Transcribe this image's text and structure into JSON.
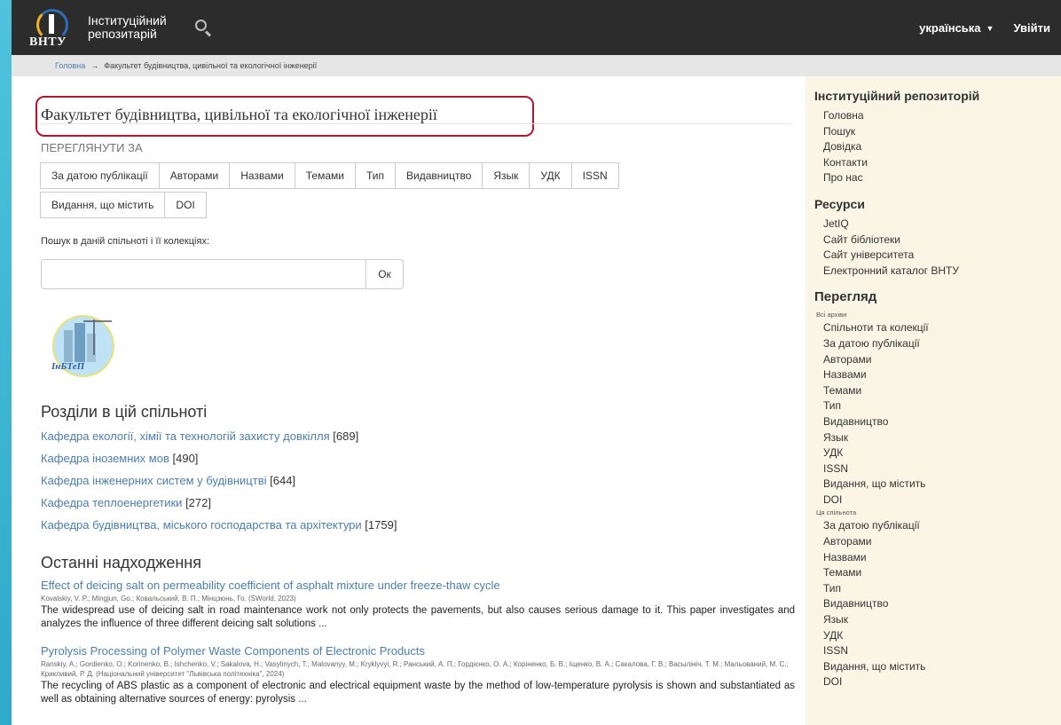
{
  "navbar": {
    "logo_text": "ВНТУ",
    "brand_line1": "Інституційний",
    "brand_line2": "репозитарій",
    "language": "українська",
    "login": "Увійти"
  },
  "breadcrumb": {
    "home": "Головна",
    "separator": "→",
    "current": "Факультет будівництва, цивільної та екологічної інженерії"
  },
  "main": {
    "title": "Факультет будівництва, цивільної та екологічної інженерії",
    "browse_label": "ПЕРЕГЛЯНУТИ ЗА",
    "browse_buttons_row1": [
      "За датою публікації",
      "Авторами",
      "Назвами",
      "Темами",
      "Тип",
      "Видавництво",
      "Язык",
      "УДК",
      "ISSN"
    ],
    "browse_buttons_row2": [
      "Видання, що містить",
      "DOI"
    ],
    "search_label": "Пошук в даній спільноті і її колекціях:",
    "search_button": "Ок",
    "logo_text": "ІнБТеП",
    "subdivisions_heading": "Розділи в цій спільноті",
    "subdivisions": [
      {
        "name": "Кафедра екології, хімії та технологій захисту довкілля",
        "count": "[689]"
      },
      {
        "name": "Кафедра іноземних мов",
        "count": "[490]"
      },
      {
        "name": "Кафедра інженерних систем у будівництві",
        "count": "[644]"
      },
      {
        "name": "Кафедра теплоенергетики",
        "count": "[272]"
      },
      {
        "name": "Кафедра будівництва, міського господарства та архітектури",
        "count": "[1759]"
      }
    ],
    "recent_heading": "Останні надходження",
    "recent": [
      {
        "title": "Effect of deicing salt on permeability coefficient of asphalt mixture under freeze-thaw cycle",
        "authors": "Kovalskiy, V. P.; Mingjun, Go.; Ковальський, В. П.; Мінцзюнь, Го. (SWorld, 2023)",
        "abstract": "The widespread use of deicing salt in road maintenance work not only protects the pavements, but also causes serious damage to it. This paper investigates and analyzes the influence of three different deicing salt solutions ..."
      },
      {
        "title": "Pyrolysis Processing of Polymer Waste Components of Electronic Products",
        "authors": "Ranskiy, A.; Gordienko, O.; Korinenko, B.; Ishchenko, V.; Sakalova, H.; Vasylinych, T.; Malovanyy, M.; Kryklyvyi, R.; Ранський, А. П.; Гордієнко, О. А.; Коріненко, Б. В.; Іщенко, В. А.; Сакалова, Г. В.; Васылініч, Т. М.; Мальований, М. С.; Крикливий, Р. Д. (Національний університет \"Львівська політехніка\", 2024)",
        "abstract": "The recycling of ABS plastic as a component of electronic and electrical equipment waste by the method of low-temperature pyrolysis is shown and substantiated as well as obtaining alternative sources of energy: pyrolysis ..."
      }
    ]
  },
  "sidebar": {
    "repo_heading": "Інституційний репозиторій",
    "repo_items": [
      "Головна",
      "Пошук",
      "Довідка",
      "Контакти",
      "Про нас"
    ],
    "resources_heading": "Ресурси",
    "resources_items": [
      "JetIQ",
      "Сайт бібліотеки",
      "Сайт університета",
      "Електронний каталог ВНТУ"
    ],
    "browse_heading": "Перегляд",
    "all_archives_label": "Всі архіви",
    "all_archives_items": [
      "Спільноти та колекції",
      "За датою публікації",
      "Авторами",
      "Назвами",
      "Темами",
      "Тип",
      "Видавництво",
      "Язык",
      "УДК",
      "ISSN",
      "Видання, що містить",
      "DOI"
    ],
    "this_community_label": "Ця спільнота",
    "this_community_items": [
      "За датою публікації",
      "Авторами",
      "Назвами",
      "Темами",
      "Тип",
      "Видавництво",
      "Язык",
      "УДК",
      "ISSN",
      "Видання, що містить",
      "DOI"
    ]
  },
  "colors": {
    "accent_link": "#4b7eb0",
    "navbar_bg": "#2c2c2c",
    "highlight_border": "#b0172d",
    "sidebar_bg": "#fbf5e6"
  }
}
